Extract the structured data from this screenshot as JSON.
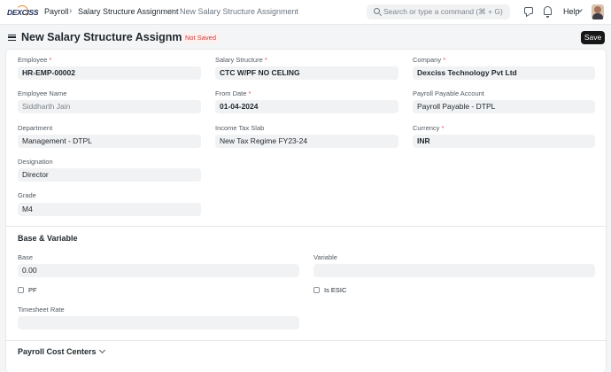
{
  "navbar": {
    "logo_text": "DEXCISS",
    "breadcrumbs": [
      "Payroll",
      "Salary Structure Assignment",
      "New Salary Structure Assignment"
    ],
    "search_placeholder": "Search or type a command (⌘ + G)",
    "help_label": "Help",
    "icons": [
      "chat-icon",
      "bell-icon",
      "chevron-down-icon",
      "avatar"
    ]
  },
  "page": {
    "title": "New Salary Structure Assignment",
    "status_badge": "Not Saved",
    "save_label": "Save"
  },
  "details": {
    "employee": {
      "label": "Employee",
      "value": "HR-EMP-00002"
    },
    "employee_name": {
      "label": "Employee Name",
      "value": "Siddharth Jain"
    },
    "department": {
      "label": "Department",
      "value": "Management - DTPL"
    },
    "designation": {
      "label": "Designation",
      "value": "Director"
    },
    "grade": {
      "label": "Grade",
      "value": "M4"
    },
    "salary_structure": {
      "label": "Salary Structure",
      "value": "CTC W/PF NO CELING"
    },
    "from_date": {
      "label": "From Date",
      "value": "01-04-2024"
    },
    "income_tax_slab": {
      "label": "Income Tax Slab",
      "value": "New Tax Regime FY23-24"
    },
    "company": {
      "label": "Company",
      "value": "Dexciss Technology Pvt Ltd"
    },
    "payroll_payable_account": {
      "label": "Payroll Payable Account",
      "value": "Payroll Payable - DTPL"
    },
    "currency": {
      "label": "Currency",
      "value": "INR"
    },
    "required_marker": "*"
  },
  "base_variable": {
    "title": "Base & Variable",
    "base": {
      "label": "Base",
      "value": "0.00"
    },
    "variable": {
      "label": "Variable",
      "value": ""
    },
    "pf": {
      "label": "PF",
      "checked": false
    },
    "is_esic": {
      "label": "Is ESIC",
      "checked": false
    },
    "timesheet_rate": {
      "label": "Timesheet Rate",
      "value": ""
    }
  },
  "payroll_cost_centers": {
    "title": "Payroll Cost Centers"
  }
}
